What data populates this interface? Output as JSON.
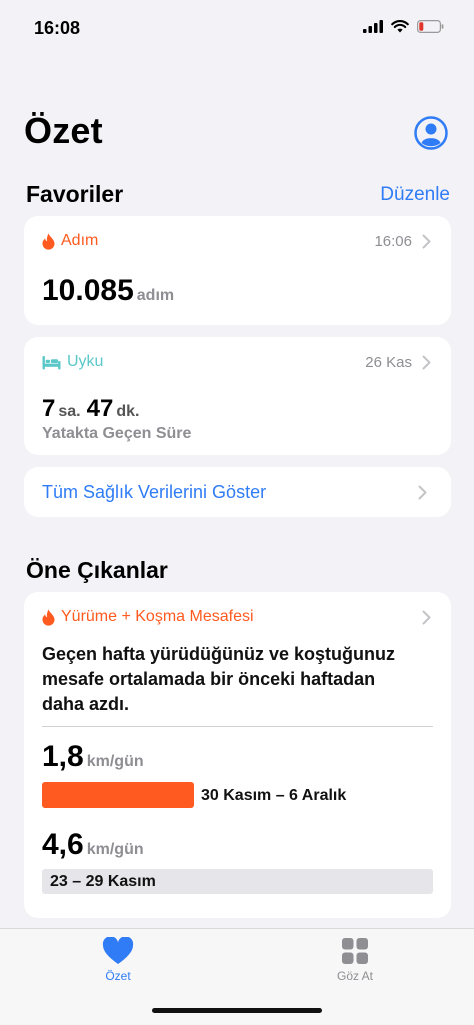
{
  "status_bar": {
    "time": "16:08"
  },
  "header": {
    "title": "Özet"
  },
  "favorites": {
    "title": "Favoriler",
    "edit_label": "Düzenle",
    "steps": {
      "category": "Adım",
      "time": "16:06",
      "value": "10.085",
      "unit": "adım"
    },
    "sleep": {
      "category": "Uyku",
      "date": "26 Kas",
      "hours": "7",
      "hours_unit": "sa.",
      "minutes": "47",
      "minutes_unit": "dk.",
      "caption": "Yatakta Geçen Süre"
    },
    "show_all_label": "Tüm Sağlık Verilerini Göster"
  },
  "highlights": {
    "title": "Öne Çıkanlar",
    "card": {
      "category": "Yürüme + Koşma Mesafesi",
      "description": "Geçen hafta yürüdüğünüz ve koştuğunuz mesafe ortalamada bir önceki haftadan daha azdı.",
      "current": {
        "value": "1,8",
        "unit": "km/gün",
        "range": "30 Kasım – 6 Aralık"
      },
      "previous": {
        "value": "4,6",
        "unit": "km/gün",
        "range": "23 – 29 Kasım"
      }
    }
  },
  "tabbar": {
    "summary_label": "Özet",
    "browse_label": "Göz At"
  },
  "colors": {
    "accent_blue": "#2f7cf6",
    "activity_orange": "#ff5a1f",
    "sleep_teal": "#5ac8c8",
    "background": "#f2f2f7"
  }
}
